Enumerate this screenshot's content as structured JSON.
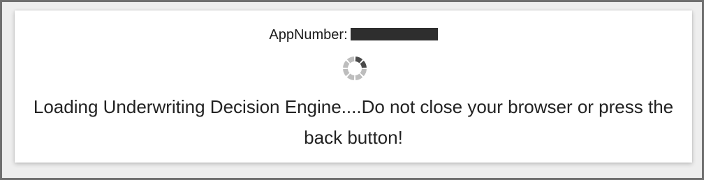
{
  "app_number": {
    "label": "AppNumber:",
    "value_redacted": true
  },
  "spinner": {
    "icon": "loading-spinner-icon",
    "active_color": "#4a4a4a",
    "inactive_color": "#bdbdbd"
  },
  "message": {
    "text": "Loading Underwriting Decision Engine....Do not close your browser or press the back button!"
  }
}
